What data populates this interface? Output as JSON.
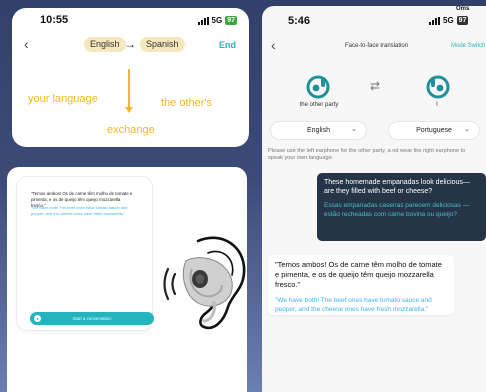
{
  "panel_a": {
    "status": {
      "time": "10:55",
      "network": "5G",
      "battery": "97"
    },
    "back_icon": "chevron-left-icon",
    "source_lang": "English",
    "target_lang": "Spanish",
    "arrow_icon": "arrow-right-icon",
    "end_label": "End",
    "your_language": "your language",
    "others": "the other's",
    "exchange": "exchange",
    "accent": "#f1b62b"
  },
  "panel_b": {
    "status": {
      "time": "5:46",
      "carrier": "Oms",
      "network": "5G",
      "battery": "97"
    },
    "title": "Face-to-face translation",
    "mode_switch": "Mode Switch",
    "left_party_label": "the other party",
    "right_party_label": "I",
    "swap_icon": "swap-arrows-icon",
    "left_select": "English",
    "right_select": "Portuguese",
    "hint": "Please use the left earphone for the other party, a nd wear the right earphone to speak your own language.",
    "dark_bubble": {
      "english": "These homemade empanadas look delicious—are they filled with beef or cheese?",
      "translation": "Essas empanadas caseiras parecem deliciosas — estão recheadas com carne bovina ou queijo?"
    },
    "light_bubble": {
      "portuguese": "\"Temos ambos! Os de carne têm molho de tomate e pimenta, e os de queijo têm queijo mozzarella fresco.\"",
      "translation": "\"We have both! The beef ones have tomato sauce and pepper, and the cheese ones have fresh mozzarella.\""
    },
    "accent": "#25b5be",
    "dark_bubble_color": "#263448"
  },
  "panel_c": {
    "quote": "\"Temos ambos! Os de carne têm molho de tomate e pimenta, e os de queijo têm queijo mozzarella fresco.\"",
    "translation": "\"We have both! The beef ones have tomato sauce and pepper, and the cheese ones have fresh mozzarella.\"",
    "start_button": "Start a conversation",
    "mic_icon": "microphone-icon",
    "illustration": "ear-with-earphone-icon"
  }
}
